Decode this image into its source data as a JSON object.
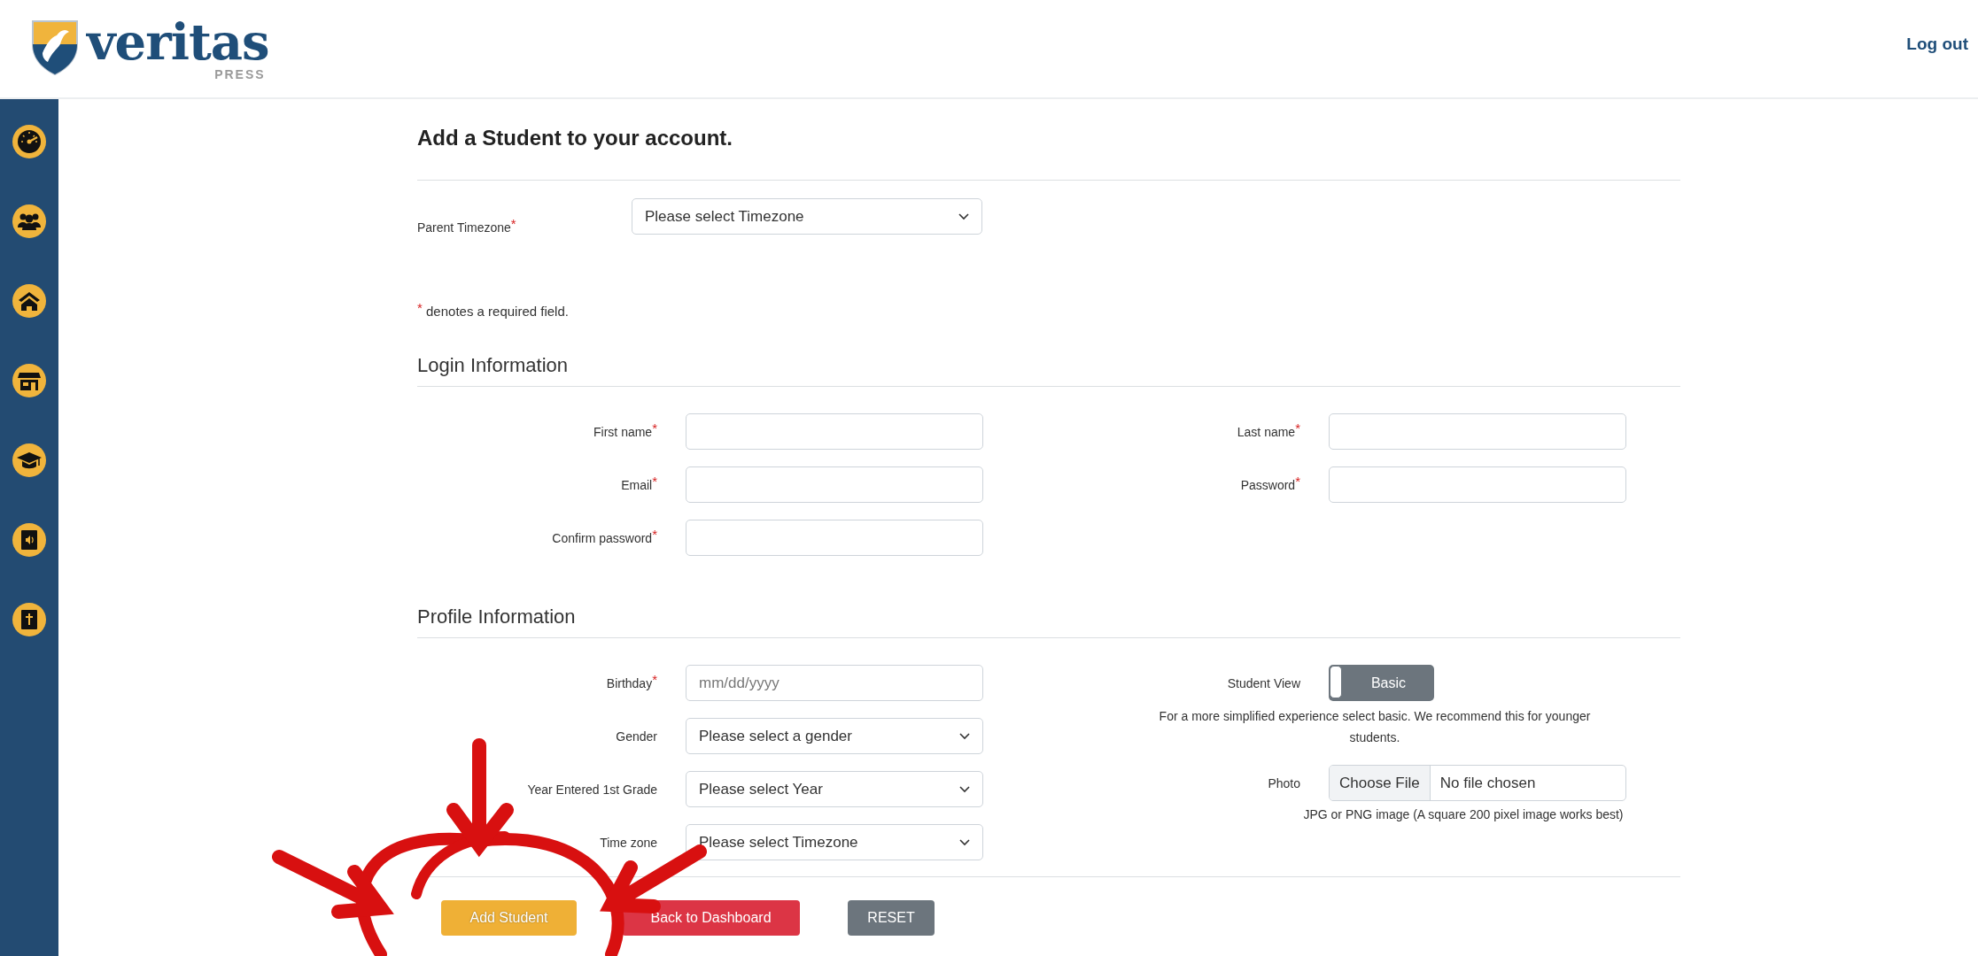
{
  "header": {
    "logo": {
      "name": "veritas",
      "tagline": "PRESS"
    },
    "logout": "Log out"
  },
  "sidebar": {
    "items": [
      {
        "kind": "gauge"
      },
      {
        "kind": "people"
      },
      {
        "kind": "house"
      },
      {
        "kind": "store"
      },
      {
        "kind": "cap"
      },
      {
        "kind": "audio-book"
      },
      {
        "kind": "bible"
      }
    ]
  },
  "required_mark": "*",
  "page": {
    "title": "Add a Student to your account.",
    "parent_timezone": {
      "label": "Parent Timezone",
      "required": true,
      "value": "Please select Timezone"
    },
    "required_note": "denotes a required field.",
    "sections": [
      {
        "title": "Login Information",
        "left": [
          {
            "kind": "text",
            "label": "First name",
            "required": true
          },
          {
            "kind": "text",
            "label": "Email",
            "required": true
          },
          {
            "kind": "text",
            "label": "Confirm password",
            "required": true
          }
        ],
        "right": [
          {
            "kind": "text",
            "label": "Last name",
            "required": true
          },
          {
            "kind": "text",
            "label": "Password",
            "required": true
          }
        ]
      },
      {
        "title": "Profile Information",
        "left": [
          {
            "kind": "date",
            "label": "Birthday",
            "required": true,
            "placeholder": "mm/dd/yyyy"
          },
          {
            "kind": "select",
            "label": "Gender",
            "required": false,
            "value": "Please select a gender"
          },
          {
            "kind": "select",
            "label": "Year Entered 1st Grade",
            "required": false,
            "value": "Please select Year"
          },
          {
            "kind": "select",
            "label": "Time zone",
            "required": false,
            "value": "Please select Timezone"
          }
        ],
        "right": [
          {
            "kind": "toggle",
            "label": "Student View",
            "required": false,
            "on": false,
            "text": "Basic",
            "note": "For a more simplified experience select basic. We recommend this for younger students."
          },
          {
            "kind": "file",
            "label": "Photo",
            "required": false,
            "button": "Choose File",
            "value": "No file chosen",
            "note": "JPG or PNG image (A square 200 pixel image works best)"
          }
        ]
      }
    ]
  },
  "buttons": [
    {
      "label": "Add Student",
      "kind": "warning"
    },
    {
      "label": "Back to Dashboard",
      "kind": "danger"
    },
    {
      "label": "RESET",
      "kind": "secondary"
    }
  ]
}
